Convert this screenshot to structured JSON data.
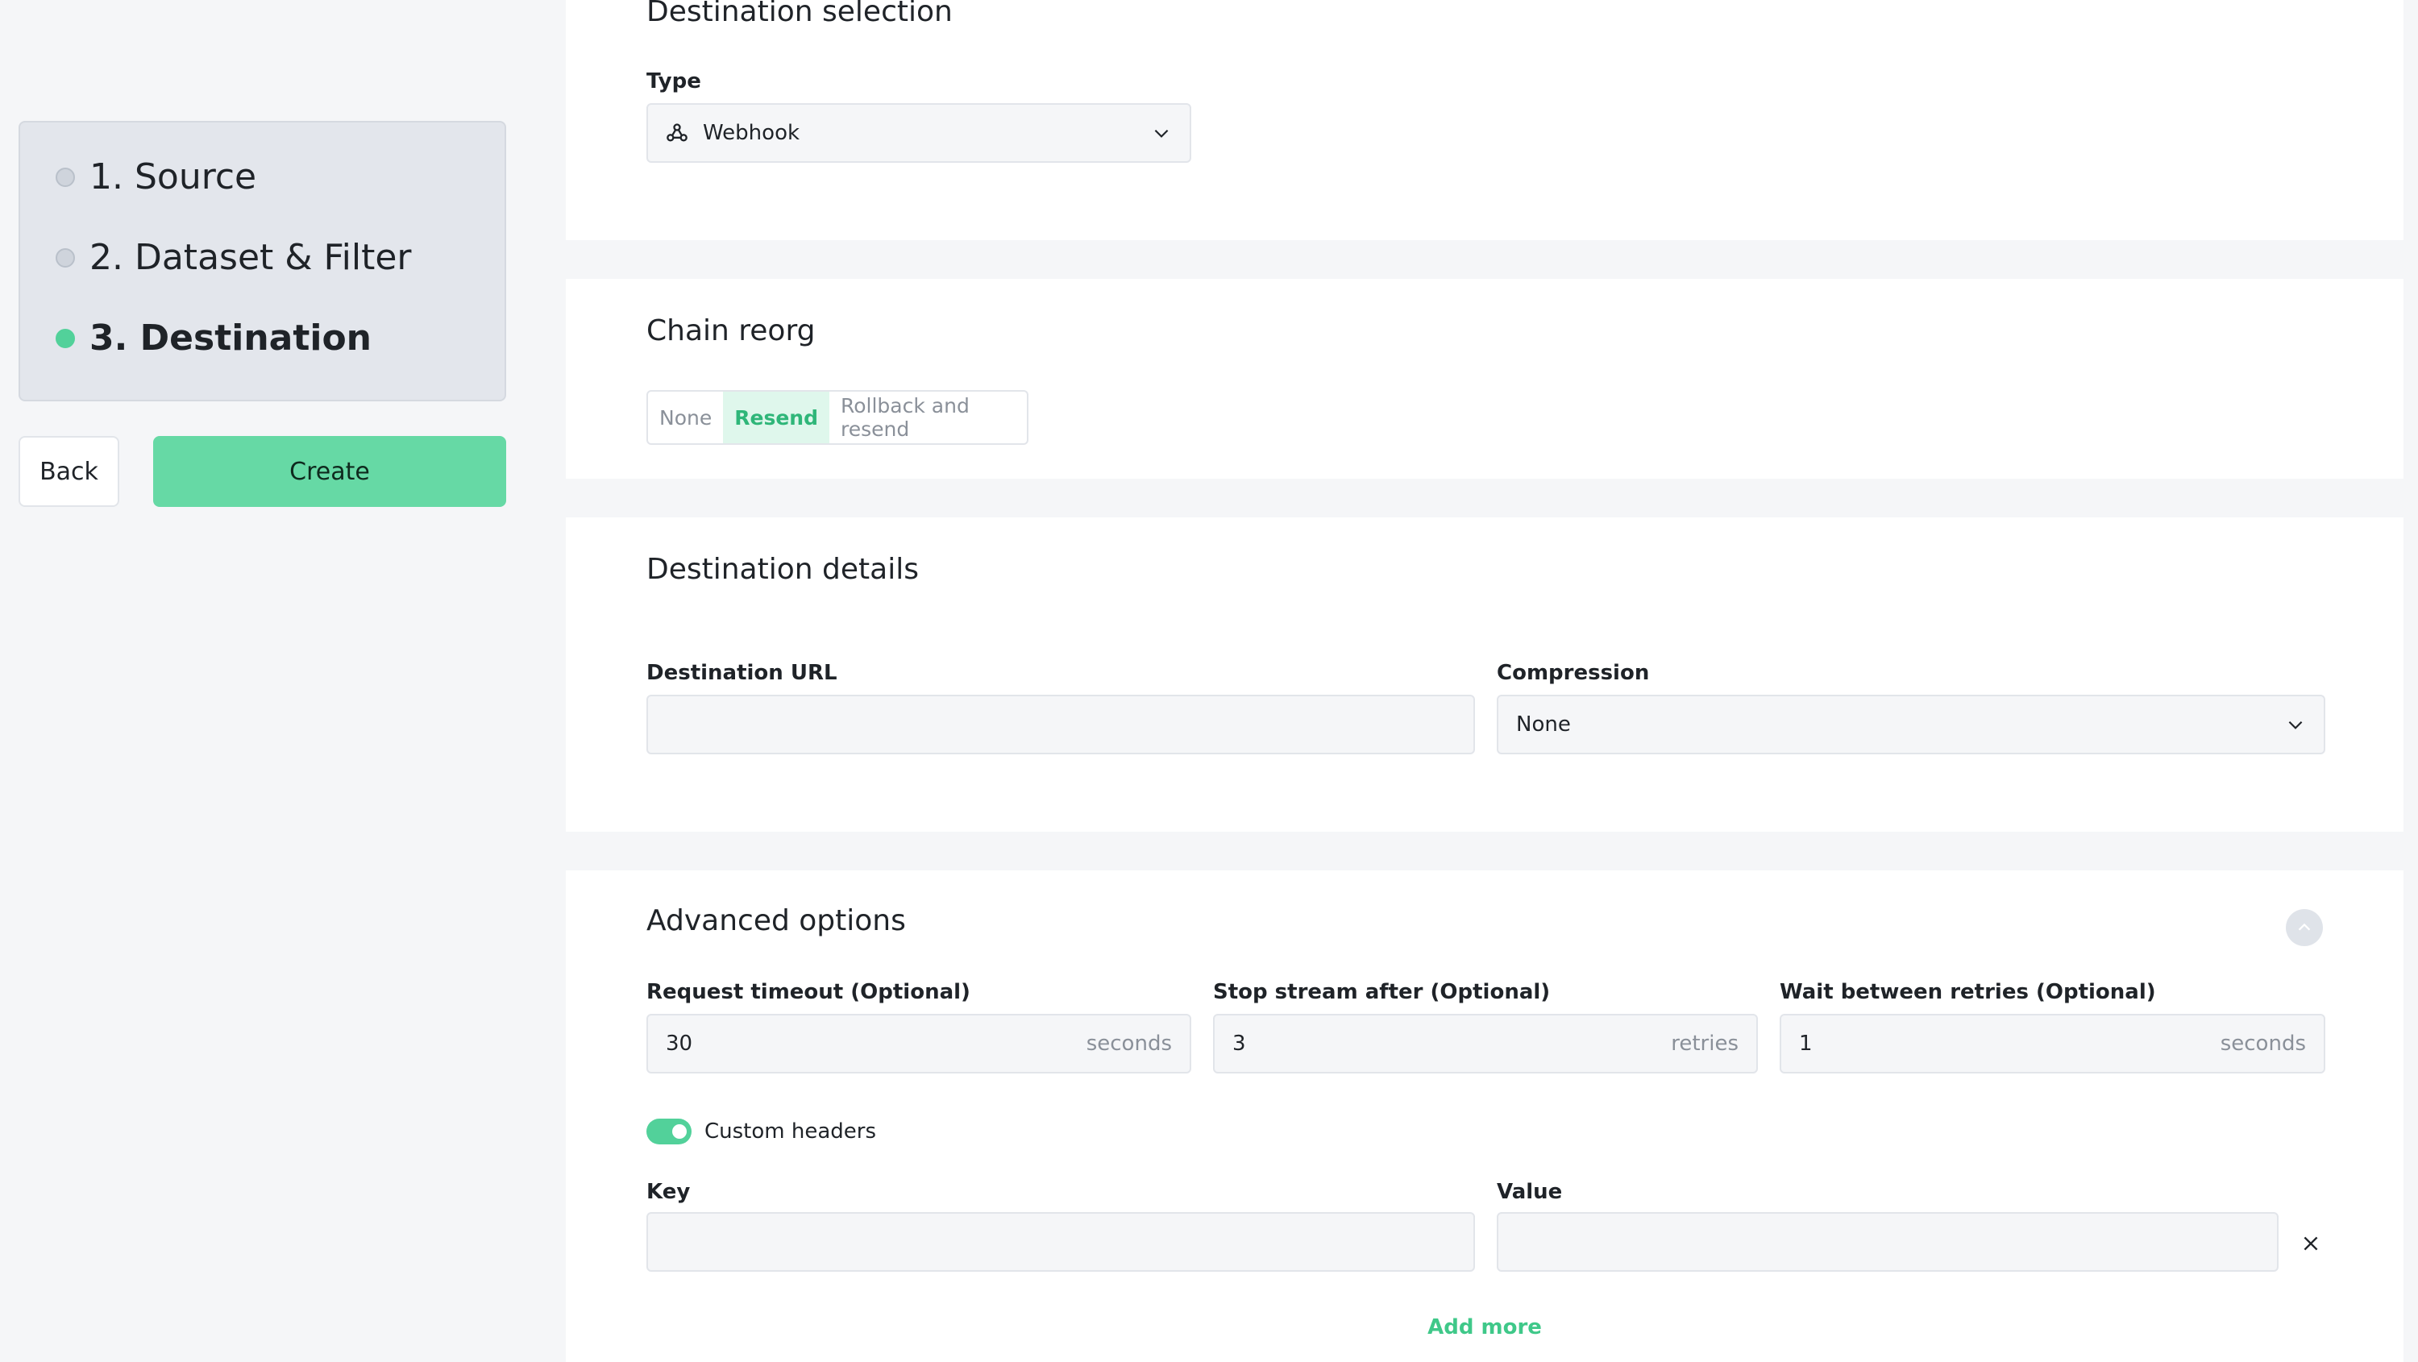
{
  "sidebar": {
    "steps": [
      {
        "label": "1. Source"
      },
      {
        "label": "2. Dataset & Filter"
      },
      {
        "label": "3. Destination"
      }
    ],
    "back_label": "Back",
    "create_label": "Create"
  },
  "destination_selection": {
    "title": "Destination selection",
    "type_label": "Type",
    "type_value": "Webhook",
    "type_icon": "webhook-icon"
  },
  "chain_reorg": {
    "title": "Chain reorg",
    "options": [
      "None",
      "Resend",
      "Rollback and resend"
    ],
    "selected": "Resend"
  },
  "destination_details": {
    "title": "Destination details",
    "url_label": "Destination URL",
    "url_value": "",
    "compression_label": "Compression",
    "compression_value": "None"
  },
  "advanced": {
    "title": "Advanced options",
    "request_timeout": {
      "label": "Request timeout (Optional)",
      "value": "30",
      "suffix": "seconds"
    },
    "stop_stream": {
      "label": "Stop stream after (Optional)",
      "value": "3",
      "suffix": "retries"
    },
    "wait_retries": {
      "label": "Wait between retries (Optional)",
      "value": "1",
      "suffix": "seconds"
    },
    "custom_headers_label": "Custom headers",
    "custom_headers_enabled": true,
    "key_label": "Key",
    "value_label": "Value",
    "key_value": "",
    "value_value": "",
    "add_more_label": "Add more"
  },
  "colors": {
    "accent": "#52d19a",
    "accent_text": "#3fc889"
  }
}
